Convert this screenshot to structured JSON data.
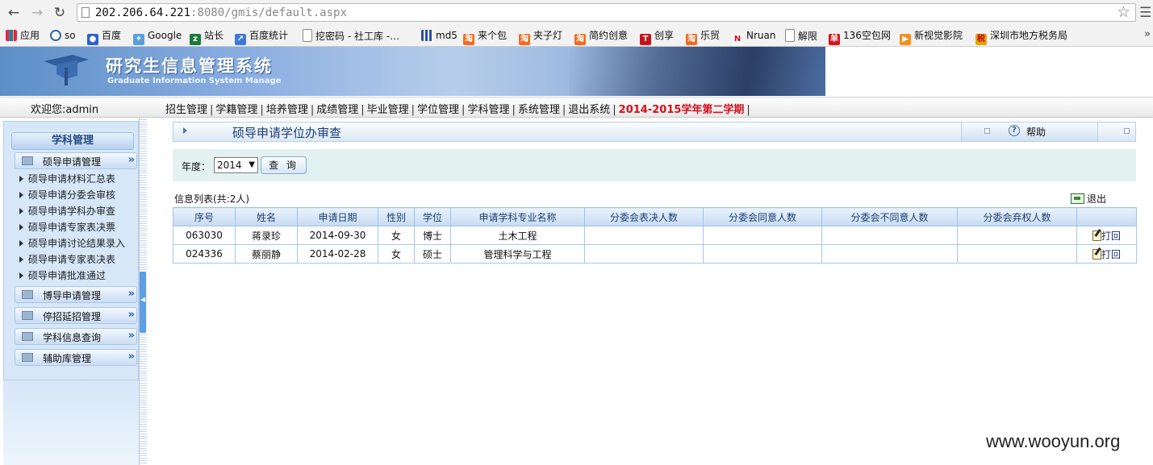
{
  "browser": {
    "url_host": "202.206.64.221",
    "url_rest": ":8080/gmis/default.aspx",
    "bookmarks": [
      "应用",
      "so",
      "百度",
      "Google",
      "站长",
      "百度统计",
      "挖密码 - 社工库 -…",
      "md5",
      "来个包",
      "夹子灯",
      "简约创意",
      "创享",
      "乐贸",
      "Nruan",
      "解限",
      "136空包网",
      "新视觉影院",
      "深圳市地方税务局"
    ],
    "more": "»"
  },
  "header": {
    "title": "研究生信息管理系统",
    "subtitle": "Graduate Information System Manage"
  },
  "menubar": {
    "welcome": "欢迎您:admin",
    "items": [
      "招生管理",
      "学籍管理",
      "培养管理",
      "成绩管理",
      "毕业管理",
      "学位管理",
      "学科管理",
      "系统管理",
      "退出系统"
    ],
    "term": "2014-2015学年第二学期"
  },
  "sidebar": {
    "title": "学科管理",
    "active_group": "硕导申请管理",
    "sub_items": [
      "硕导申请材料汇总表",
      "硕导申请分委会审核",
      "硕导申请学科办审查",
      "硕导申请专家表决票",
      "硕导申请讨论结果录入",
      "硕导申请专家表决表",
      "硕导申请批准通过"
    ],
    "other_groups": [
      "博导申请管理",
      "停招延招管理",
      "学科信息查询",
      "辅助库管理"
    ]
  },
  "page": {
    "title": "硕导申请学位办审查",
    "help": "帮助"
  },
  "search": {
    "year_label": "年度：",
    "year_value": "2014",
    "query_button": "查 询"
  },
  "list": {
    "info": "信息列表(共:2人)",
    "exit": "退出",
    "columns": [
      "序号",
      "姓名",
      "申请日期",
      "性别",
      "学位",
      "申请学科专业名称",
      "分委会表决人数",
      "分委会同意人数",
      "分委会不同意人数",
      "分委会弃权人数",
      ""
    ],
    "rows": [
      {
        "id": "063030",
        "name": "蒋录珍",
        "date": "2014-09-30",
        "gender": "女",
        "degree": "博士",
        "major": "土木工程",
        "voters": "",
        "agree": "",
        "disagree": "",
        "abstain": "",
        "action": "打回"
      },
      {
        "id": "024336",
        "name": "蔡丽静",
        "date": "2014-02-28",
        "gender": "女",
        "degree": "硕士",
        "major": "管理科学与工程",
        "voters": "",
        "agree": "",
        "disagree": "",
        "abstain": "",
        "action": "打回"
      }
    ]
  },
  "watermark": "www.wooyun.org",
  "colors": {
    "term": "#d2101a",
    "accent": "#2a63b6",
    "search_bg": "#e3f2f1"
  }
}
